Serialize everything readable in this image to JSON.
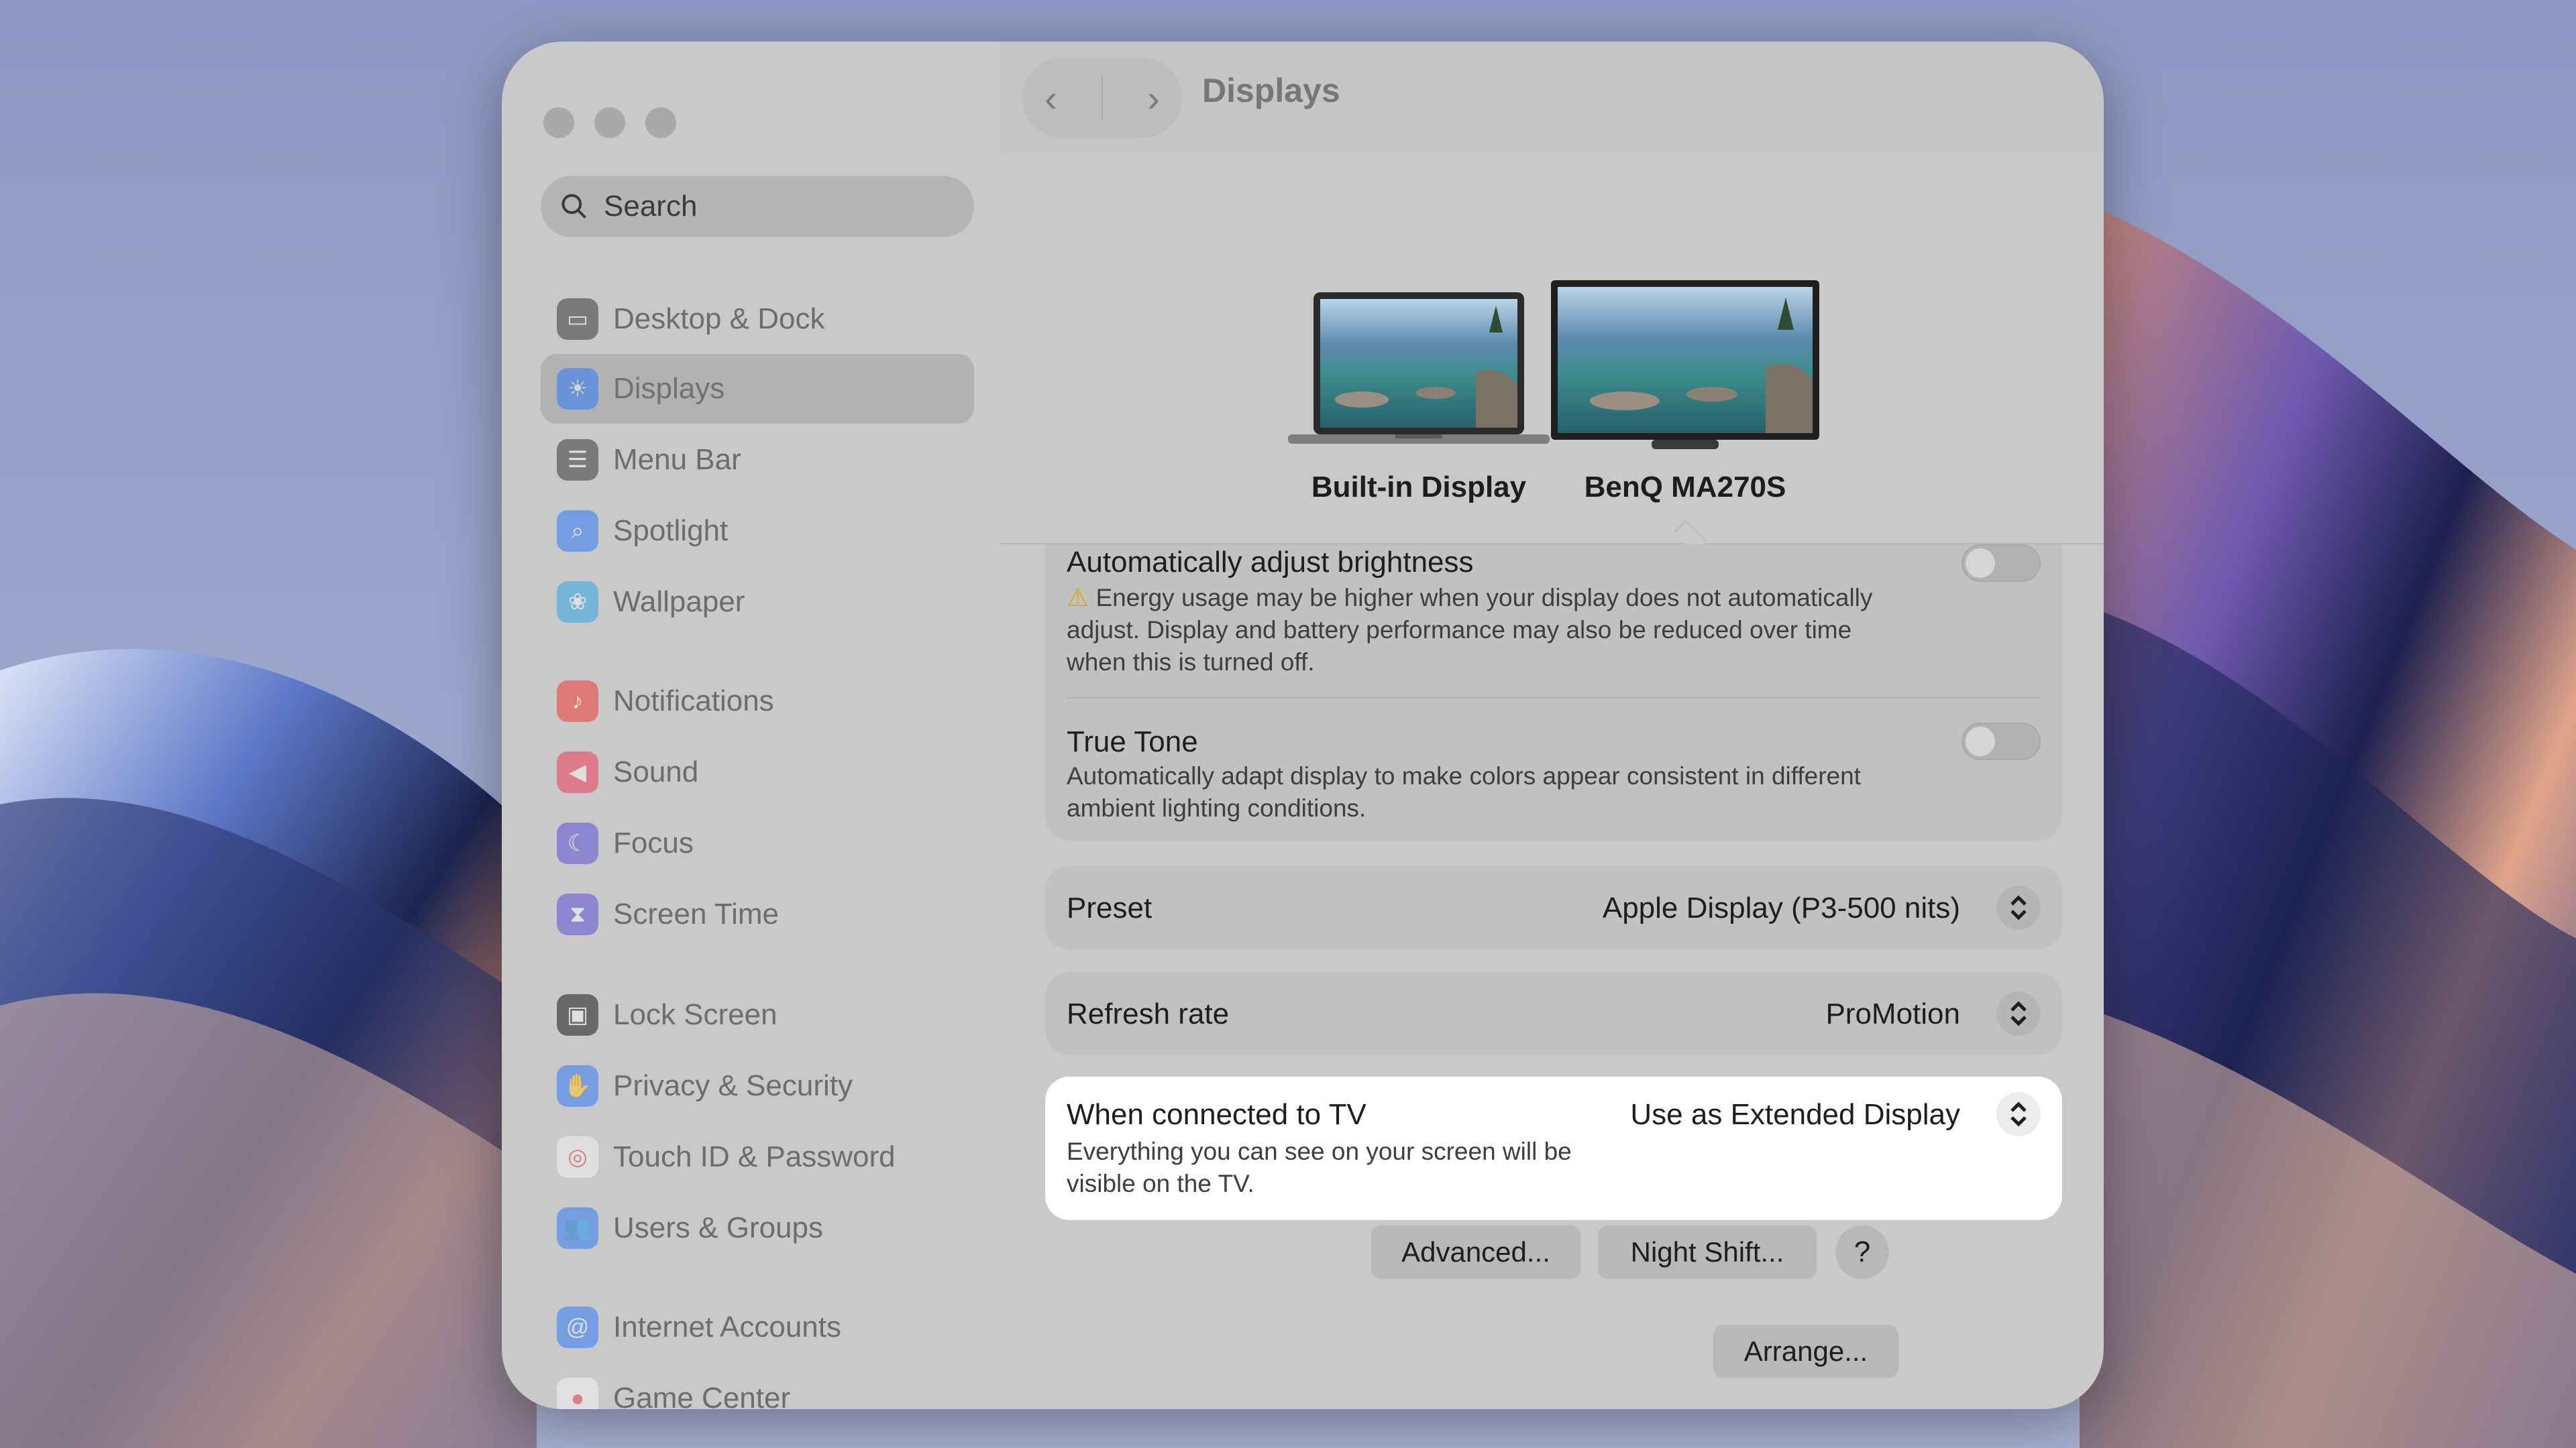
{
  "window": {
    "title": "Displays"
  },
  "sidebar": {
    "search": {
      "placeholder": "Search"
    },
    "items": [
      {
        "label": "Desktop & Dock",
        "icon": "dock-icon",
        "color": "#3a3a3c"
      },
      {
        "label": "Displays",
        "icon": "sun-icon",
        "color": "#2f7cf6",
        "active": true
      },
      {
        "label": "Menu Bar",
        "icon": "menubar-icon",
        "color": "#3a3a3c"
      },
      {
        "label": "Spotlight",
        "icon": "magnifier-icon",
        "color": "#2f7cf6"
      },
      {
        "label": "Wallpaper",
        "icon": "flower-icon",
        "color": "#32a8e6"
      },
      {
        "label": "Notifications",
        "icon": "bell-icon",
        "color": "#ef3b35"
      },
      {
        "label": "Sound",
        "icon": "speaker-icon",
        "color": "#ef3b5a"
      },
      {
        "label": "Focus",
        "icon": "moon-icon",
        "color": "#5e4fd8"
      },
      {
        "label": "Screen Time",
        "icon": "hourglass-icon",
        "color": "#5e4fd8"
      },
      {
        "label": "Lock Screen",
        "icon": "lock-icon",
        "color": "#1c1c1e"
      },
      {
        "label": "Privacy & Security",
        "icon": "hand-icon",
        "color": "#2f7cf6"
      },
      {
        "label": "Touch ID & Password",
        "icon": "fingerprint-icon",
        "color": "#f2f2f2"
      },
      {
        "label": "Users & Groups",
        "icon": "users-icon",
        "color": "#2f7cf6"
      },
      {
        "label": "Internet Accounts",
        "icon": "at-icon",
        "color": "#2f7cf6"
      },
      {
        "label": "Game Center",
        "icon": "gamecenter-icon",
        "color": "#f2f2f2"
      }
    ]
  },
  "displays": {
    "builtin_label": "Built-in Display",
    "external_label": "BenQ MA270S"
  },
  "settings": {
    "auto_brightness": {
      "title": "Automatically adjust brightness",
      "desc_line1": "Energy usage may be higher when your display does not automatically",
      "desc_line2": "adjust. Display and battery performance may also be reduced over time",
      "desc_line3": "when this is turned off.",
      "enabled": false
    },
    "true_tone": {
      "title": "True Tone",
      "desc_line1": "Automatically adapt display to make colors appear consistent in different",
      "desc_line2": "ambient lighting conditions.",
      "enabled": false
    },
    "preset": {
      "label": "Preset",
      "value": "Apple Display (P3-500 nits)"
    },
    "refresh_rate": {
      "label": "Refresh rate",
      "value": "ProMotion"
    },
    "tv": {
      "label": "When connected to TV",
      "value": "Use as Extended Display",
      "desc_line1": "Everything you can see on your screen will be",
      "desc_line2": "visible on the TV."
    }
  },
  "buttons": {
    "advanced": "Advanced...",
    "night_shift": "Night Shift...",
    "help": "?",
    "arrange": "Arrange..."
  }
}
